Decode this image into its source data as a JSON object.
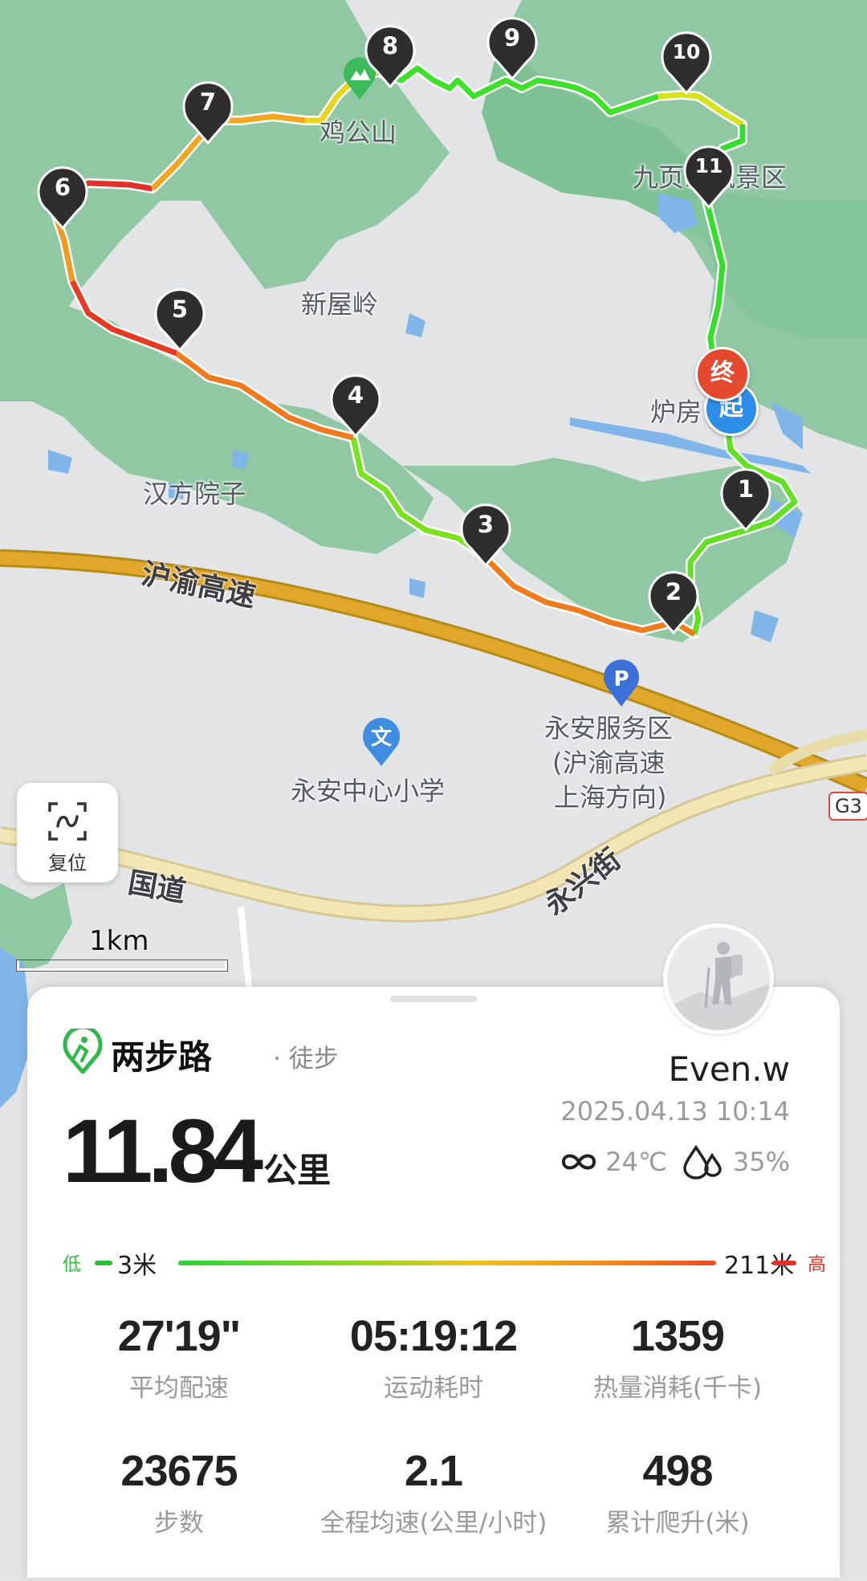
{
  "map": {
    "place_labels": {
      "jigongshan": "鸡公山",
      "jiuzhen": "九页山风景区",
      "xinwuling": "新屋岭",
      "hanfang": "汉方院子",
      "lufang": "炉房",
      "yongan_service": "永安服务区",
      "yongan_service_2": "(沪渝高速",
      "yongan_service_3": "上海方向)",
      "yongan_school": "永安中心小学"
    },
    "road_labels": {
      "huyu": "沪渝高速",
      "guodao": "国道",
      "yongxing": "永兴街",
      "g3": "G3"
    },
    "route_markers": [
      "1",
      "2",
      "3",
      "4",
      "5",
      "6",
      "7",
      "8",
      "9",
      "10",
      "11"
    ],
    "start_label": "起",
    "end_label": "终",
    "parking_icon": "parking-icon",
    "school_icon": "school-icon",
    "scale_label": "1km"
  },
  "reset_button": {
    "label": "复位",
    "icon": "track-reset-icon"
  },
  "card": {
    "brand_name": "两步路",
    "activity_type": "· 徒步",
    "distance_value": "11.84",
    "distance_unit": "公里",
    "username": "Even.w",
    "datetime": "2025.04.13 10:14",
    "weather": {
      "icon": "cloudy-infinity-icon",
      "temperature": "24℃",
      "humidity_icon": "humidity-drops-icon",
      "humidity": "35%"
    },
    "elevation": {
      "low_label": "低",
      "low_value": "3米",
      "high_value": "211米",
      "high_label": "高",
      "low_color": "#2bbf3a",
      "high_color": "#e53029"
    },
    "stats": [
      {
        "value": "27'19\"",
        "label": "平均配速"
      },
      {
        "value": "05:19:12",
        "label": "运动耗时"
      },
      {
        "value": "1359",
        "label": "热量消耗(千卡)"
      },
      {
        "value": "23675",
        "label": "步数"
      },
      {
        "value": "2.1",
        "label": "全程均速(公里/小时)"
      },
      {
        "value": "498",
        "label": "累计爬升(米)"
      }
    ]
  }
}
